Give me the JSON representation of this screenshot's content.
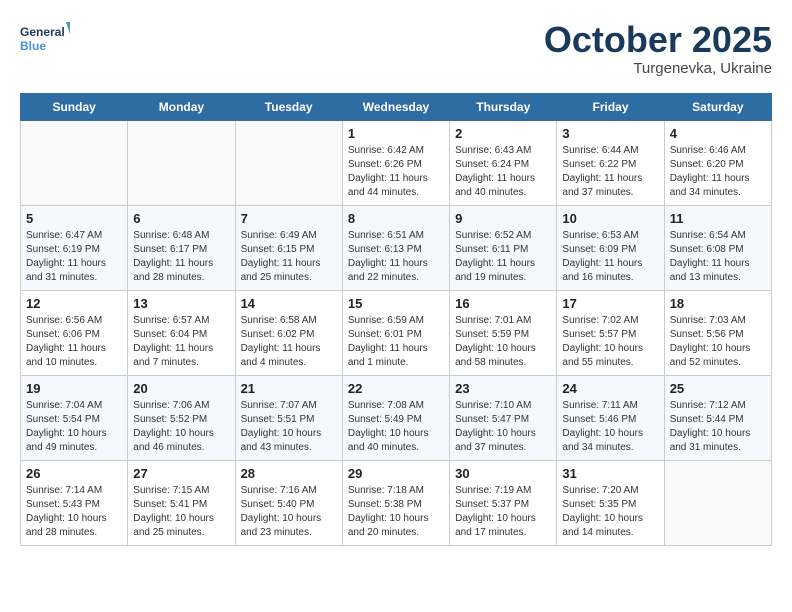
{
  "header": {
    "logo_line1": "General",
    "logo_line2": "Blue",
    "month": "October 2025",
    "location": "Turgenevka, Ukraine"
  },
  "weekdays": [
    "Sunday",
    "Monday",
    "Tuesday",
    "Wednesday",
    "Thursday",
    "Friday",
    "Saturday"
  ],
  "weeks": [
    [
      {
        "day": "",
        "info": ""
      },
      {
        "day": "",
        "info": ""
      },
      {
        "day": "",
        "info": ""
      },
      {
        "day": "1",
        "info": "Sunrise: 6:42 AM\nSunset: 6:26 PM\nDaylight: 11 hours\nand 44 minutes."
      },
      {
        "day": "2",
        "info": "Sunrise: 6:43 AM\nSunset: 6:24 PM\nDaylight: 11 hours\nand 40 minutes."
      },
      {
        "day": "3",
        "info": "Sunrise: 6:44 AM\nSunset: 6:22 PM\nDaylight: 11 hours\nand 37 minutes."
      },
      {
        "day": "4",
        "info": "Sunrise: 6:46 AM\nSunset: 6:20 PM\nDaylight: 11 hours\nand 34 minutes."
      }
    ],
    [
      {
        "day": "5",
        "info": "Sunrise: 6:47 AM\nSunset: 6:19 PM\nDaylight: 11 hours\nand 31 minutes."
      },
      {
        "day": "6",
        "info": "Sunrise: 6:48 AM\nSunset: 6:17 PM\nDaylight: 11 hours\nand 28 minutes."
      },
      {
        "day": "7",
        "info": "Sunrise: 6:49 AM\nSunset: 6:15 PM\nDaylight: 11 hours\nand 25 minutes."
      },
      {
        "day": "8",
        "info": "Sunrise: 6:51 AM\nSunset: 6:13 PM\nDaylight: 11 hours\nand 22 minutes."
      },
      {
        "day": "9",
        "info": "Sunrise: 6:52 AM\nSunset: 6:11 PM\nDaylight: 11 hours\nand 19 minutes."
      },
      {
        "day": "10",
        "info": "Sunrise: 6:53 AM\nSunset: 6:09 PM\nDaylight: 11 hours\nand 16 minutes."
      },
      {
        "day": "11",
        "info": "Sunrise: 6:54 AM\nSunset: 6:08 PM\nDaylight: 11 hours\nand 13 minutes."
      }
    ],
    [
      {
        "day": "12",
        "info": "Sunrise: 6:56 AM\nSunset: 6:06 PM\nDaylight: 11 hours\nand 10 minutes."
      },
      {
        "day": "13",
        "info": "Sunrise: 6:57 AM\nSunset: 6:04 PM\nDaylight: 11 hours\nand 7 minutes."
      },
      {
        "day": "14",
        "info": "Sunrise: 6:58 AM\nSunset: 6:02 PM\nDaylight: 11 hours\nand 4 minutes."
      },
      {
        "day": "15",
        "info": "Sunrise: 6:59 AM\nSunset: 6:01 PM\nDaylight: 11 hours\nand 1 minute."
      },
      {
        "day": "16",
        "info": "Sunrise: 7:01 AM\nSunset: 5:59 PM\nDaylight: 10 hours\nand 58 minutes."
      },
      {
        "day": "17",
        "info": "Sunrise: 7:02 AM\nSunset: 5:57 PM\nDaylight: 10 hours\nand 55 minutes."
      },
      {
        "day": "18",
        "info": "Sunrise: 7:03 AM\nSunset: 5:56 PM\nDaylight: 10 hours\nand 52 minutes."
      }
    ],
    [
      {
        "day": "19",
        "info": "Sunrise: 7:04 AM\nSunset: 5:54 PM\nDaylight: 10 hours\nand 49 minutes."
      },
      {
        "day": "20",
        "info": "Sunrise: 7:06 AM\nSunset: 5:52 PM\nDaylight: 10 hours\nand 46 minutes."
      },
      {
        "day": "21",
        "info": "Sunrise: 7:07 AM\nSunset: 5:51 PM\nDaylight: 10 hours\nand 43 minutes."
      },
      {
        "day": "22",
        "info": "Sunrise: 7:08 AM\nSunset: 5:49 PM\nDaylight: 10 hours\nand 40 minutes."
      },
      {
        "day": "23",
        "info": "Sunrise: 7:10 AM\nSunset: 5:47 PM\nDaylight: 10 hours\nand 37 minutes."
      },
      {
        "day": "24",
        "info": "Sunrise: 7:11 AM\nSunset: 5:46 PM\nDaylight: 10 hours\nand 34 minutes."
      },
      {
        "day": "25",
        "info": "Sunrise: 7:12 AM\nSunset: 5:44 PM\nDaylight: 10 hours\nand 31 minutes."
      }
    ],
    [
      {
        "day": "26",
        "info": "Sunrise: 7:14 AM\nSunset: 5:43 PM\nDaylight: 10 hours\nand 28 minutes."
      },
      {
        "day": "27",
        "info": "Sunrise: 7:15 AM\nSunset: 5:41 PM\nDaylight: 10 hours\nand 25 minutes."
      },
      {
        "day": "28",
        "info": "Sunrise: 7:16 AM\nSunset: 5:40 PM\nDaylight: 10 hours\nand 23 minutes."
      },
      {
        "day": "29",
        "info": "Sunrise: 7:18 AM\nSunset: 5:38 PM\nDaylight: 10 hours\nand 20 minutes."
      },
      {
        "day": "30",
        "info": "Sunrise: 7:19 AM\nSunset: 5:37 PM\nDaylight: 10 hours\nand 17 minutes."
      },
      {
        "day": "31",
        "info": "Sunrise: 7:20 AM\nSunset: 5:35 PM\nDaylight: 10 hours\nand 14 minutes."
      },
      {
        "day": "",
        "info": ""
      }
    ]
  ]
}
